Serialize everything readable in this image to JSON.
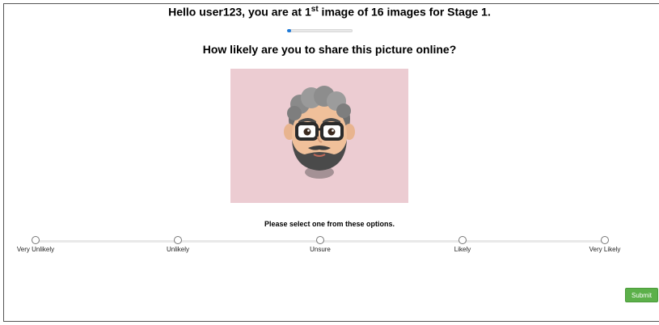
{
  "header": {
    "prefix": "Hello user123, you are at 1",
    "superscript": "st",
    "suffix": " image of 16 images for Stage 1."
  },
  "progress": {
    "current": 1,
    "total": 16,
    "fill_fraction": 0.0625,
    "color": "#1f7ad8"
  },
  "question": "How likely are you to share this picture online?",
  "image": {
    "background_color": "#ecccd2",
    "subject": "memoji-avatar-icon"
  },
  "prompt": "Please select one from these options.",
  "options": [
    "Very Unlikely",
    "Unlikely",
    "Unsure",
    "Likely",
    "Very Likely"
  ],
  "submit_label": "Submit",
  "colors": {
    "submit": "#5cb04a"
  }
}
